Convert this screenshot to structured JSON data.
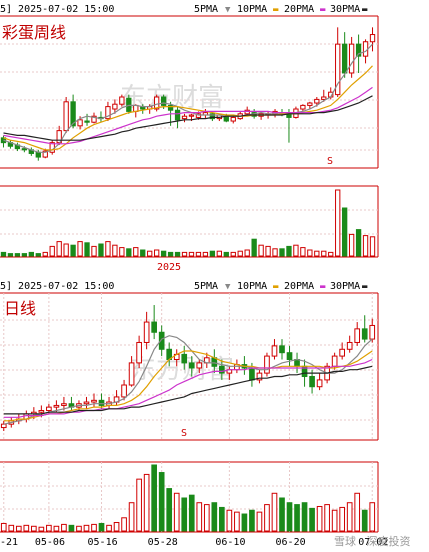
{
  "colors": {
    "up": "#d00000",
    "down": "#1a8a1a",
    "ma5": "#888888",
    "ma10": "#e0a000",
    "ma20": "#cc33cc",
    "ma30": "#222222",
    "grid_red": "#cc0000",
    "grid_dash": "#e8c8c8"
  },
  "weekly": {
    "header_left": "5] 2025-07-02 15:00",
    "title": "彩蛋周线",
    "legend": [
      "5PMA",
      "10PMA",
      "20PMA",
      "30PMA"
    ],
    "marker": "S",
    "axis_label": "2025",
    "watermark": "东方财富"
  },
  "daily": {
    "header_left": "5] 2025-07-02 15:00",
    "title": "日线",
    "legend": [
      "5PMA",
      "10PMA",
      "20PMA",
      "30PMA"
    ],
    "marker": "S",
    "watermark": "东方财富",
    "watermark_bottom": "雪球 · 深度投资",
    "x_ticks": [
      "-21",
      "05-06",
      "05-16",
      "05-28",
      "06-10",
      "06-20",
      "07-02"
    ]
  },
  "chart_data": [
    {
      "type": "candlestick",
      "title": "彩蛋周线",
      "timestamp": "2025-07-02 15:00",
      "indicators": [
        "5PMA",
        "10PMA",
        "20PMA",
        "30PMA"
      ],
      "y_range": [
        0,
        100
      ],
      "candles": [
        [
          50,
          52,
          46,
          42
        ],
        [
          46,
          48,
          43,
          41
        ],
        [
          44,
          46,
          41,
          39
        ],
        [
          41,
          43,
          40,
          38
        ],
        [
          40,
          42,
          37,
          35
        ],
        [
          38,
          40,
          34,
          31
        ],
        [
          34,
          41,
          39,
          33
        ],
        [
          38,
          48,
          46,
          36
        ],
        [
          46,
          60,
          56,
          44
        ],
        [
          56,
          84,
          80,
          54
        ],
        [
          80,
          86,
          60,
          58
        ],
        [
          60,
          68,
          65,
          57
        ],
        [
          64,
          70,
          63,
          60
        ],
        [
          63,
          71,
          68,
          62
        ],
        [
          67,
          72,
          66,
          63
        ],
        [
          66,
          80,
          76,
          64
        ],
        [
          74,
          82,
          78,
          70
        ],
        [
          78,
          86,
          84,
          76
        ],
        [
          83,
          86,
          72,
          70
        ],
        [
          72,
          78,
          77,
          67
        ],
        [
          76,
          78,
          74,
          70
        ],
        [
          74,
          78,
          76,
          70
        ],
        [
          74,
          86,
          84,
          72
        ],
        [
          84,
          86,
          77,
          74
        ],
        [
          77,
          80,
          73,
          60
        ],
        [
          73,
          76,
          65,
          58
        ],
        [
          66,
          70,
          68,
          63
        ],
        [
          68,
          70,
          69,
          64
        ],
        [
          67,
          72,
          70,
          65
        ],
        [
          69,
          74,
          71,
          66
        ],
        [
          70,
          72,
          66,
          64
        ],
        [
          66,
          70,
          69,
          64
        ],
        [
          68,
          70,
          64,
          63
        ],
        [
          64,
          69,
          67,
          62
        ],
        [
          66,
          72,
          70,
          65
        ],
        [
          70,
          76,
          73,
          68
        ],
        [
          71,
          74,
          68,
          66
        ],
        [
          68,
          72,
          70,
          65
        ],
        [
          69,
          72,
          70,
          66
        ],
        [
          70,
          74,
          72,
          67
        ],
        [
          71,
          74,
          70,
          68
        ],
        [
          70,
          74,
          67,
          46
        ],
        [
          67,
          76,
          74,
          66
        ],
        [
          74,
          78,
          77,
          72
        ],
        [
          77,
          80,
          79,
          74
        ],
        [
          79,
          84,
          82,
          76
        ],
        [
          82,
          90,
          84,
          80
        ],
        [
          84,
          92,
          88,
          82
        ],
        [
          86,
          142,
          128,
          84
        ],
        [
          128,
          138,
          104,
          100
        ],
        [
          104,
          134,
          128,
          100
        ],
        [
          128,
          136,
          118,
          104
        ],
        [
          118,
          132,
          130,
          112
        ],
        [
          130,
          142,
          136,
          122
        ]
      ],
      "ma5": [
        48,
        46,
        44,
        42,
        40,
        38,
        38,
        40,
        45,
        55,
        62,
        66,
        68,
        67,
        66,
        68,
        71,
        75,
        77,
        77,
        76,
        76,
        78,
        79,
        78,
        76,
        73,
        71,
        69,
        69,
        69,
        69,
        68,
        68,
        68,
        69,
        70,
        71,
        70,
        70,
        71,
        70,
        71,
        72,
        74,
        77,
        81,
        84,
        95,
        103,
        112,
        120,
        122,
        128
      ],
      "ma10": [
        50,
        48,
        47,
        46,
        44,
        42,
        40,
        40,
        41,
        45,
        50,
        54,
        58,
        61,
        63,
        65,
        67,
        69,
        71,
        72,
        73,
        74,
        75,
        76,
        76,
        76,
        75,
        74,
        73,
        72,
        71,
        70,
        69,
        69,
        68,
        68,
        69,
        69,
        69,
        69,
        70,
        70,
        70,
        71,
        72,
        73,
        75,
        77,
        82,
        88,
        94,
        99,
        104,
        110
      ],
      "ma20": [
        52,
        51,
        50,
        49,
        48,
        47,
        46,
        45,
        45,
        45,
        46,
        47,
        49,
        51,
        53,
        55,
        57,
        59,
        61,
        63,
        65,
        66,
        68,
        69,
        70,
        70,
        71,
        71,
        71,
        72,
        72,
        72,
        72,
        72,
        72,
        72,
        72,
        72,
        72,
        71,
        71,
        71,
        71,
        71,
        71,
        71,
        72,
        73,
        75,
        78,
        81,
        84,
        88,
        92
      ],
      "ma30": [
        54,
        53,
        52,
        52,
        51,
        50,
        49,
        48,
        48,
        48,
        48,
        48,
        49,
        50,
        51,
        52,
        53,
        55,
        56,
        58,
        59,
        60,
        61,
        62,
        63,
        64,
        65,
        65,
        66,
        66,
        67,
        67,
        68,
        68,
        68,
        69,
        69,
        69,
        69,
        69,
        69,
        70,
        70,
        70,
        70,
        71,
        71,
        72,
        73,
        75,
        77,
        79,
        82,
        85
      ],
      "volume": [
        3,
        2,
        2,
        2,
        3,
        2,
        3,
        8,
        12,
        10,
        9,
        12,
        11,
        8,
        10,
        12,
        9,
        7,
        6,
        7,
        5,
        4,
        5,
        4,
        3,
        3,
        3,
        3,
        3,
        3,
        4,
        4,
        3,
        3,
        4,
        5,
        14,
        9,
        8,
        6,
        6,
        8,
        9,
        7,
        5,
        4,
        4,
        3,
        55,
        40,
        18,
        22,
        17,
        16
      ]
    },
    {
      "type": "candlestick",
      "title": "日线",
      "timestamp": "2025-07-02 15:00",
      "indicators": [
        "5PMA",
        "10PMA",
        "20PMA",
        "30PMA"
      ],
      "x_ticks": [
        "-21",
        "05-06",
        "05-16",
        "05-28",
        "06-10",
        "06-20",
        "07-02"
      ],
      "candles": [
        [
          20,
          24,
          22,
          18
        ],
        [
          22,
          26,
          24,
          20
        ],
        [
          24,
          28,
          25,
          22
        ],
        [
          25,
          30,
          28,
          23
        ],
        [
          28,
          32,
          29,
          25
        ],
        [
          29,
          33,
          30,
          26
        ],
        [
          30,
          34,
          32,
          28
        ],
        [
          32,
          36,
          33,
          29
        ],
        [
          33,
          38,
          34,
          30
        ],
        [
          34,
          38,
          32,
          30
        ],
        [
          32,
          36,
          34,
          30
        ],
        [
          34,
          38,
          35,
          31
        ],
        [
          35,
          40,
          36,
          32
        ],
        [
          36,
          40,
          33,
          31
        ],
        [
          33,
          38,
          35,
          31
        ],
        [
          35,
          42,
          38,
          33
        ],
        [
          38,
          48,
          45,
          36
        ],
        [
          45,
          62,
          58,
          44
        ],
        [
          58,
          74,
          70,
          55
        ],
        [
          70,
          88,
          82,
          66
        ],
        [
          82,
          92,
          76,
          72
        ],
        [
          76,
          80,
          66,
          62
        ],
        [
          66,
          70,
          60,
          56
        ],
        [
          60,
          66,
          63,
          56
        ],
        [
          63,
          68,
          58,
          54
        ],
        [
          58,
          62,
          55,
          50
        ],
        [
          55,
          60,
          58,
          52
        ],
        [
          58,
          64,
          61,
          55
        ],
        [
          61,
          66,
          56,
          52
        ],
        [
          56,
          60,
          52,
          48
        ],
        [
          52,
          56,
          54,
          48
        ],
        [
          54,
          60,
          57,
          52
        ],
        [
          57,
          62,
          55,
          51
        ],
        [
          55,
          58,
          48,
          44
        ],
        [
          48,
          54,
          52,
          46
        ],
        [
          52,
          64,
          62,
          50
        ],
        [
          62,
          72,
          68,
          60
        ],
        [
          68,
          72,
          64,
          60
        ],
        [
          64,
          68,
          60,
          56
        ],
        [
          60,
          64,
          56,
          52
        ],
        [
          56,
          60,
          50,
          44
        ],
        [
          50,
          54,
          44,
          40
        ],
        [
          44,
          52,
          48,
          42
        ],
        [
          48,
          58,
          56,
          46
        ],
        [
          56,
          64,
          62,
          54
        ],
        [
          62,
          70,
          66,
          60
        ],
        [
          66,
          74,
          70,
          64
        ],
        [
          70,
          82,
          78,
          68
        ],
        [
          78,
          86,
          72,
          70
        ],
        [
          72,
          84,
          80,
          70
        ]
      ],
      "ma5": [
        22,
        23,
        24,
        25,
        27,
        28,
        29,
        30,
        31,
        32,
        33,
        33,
        34,
        34,
        34,
        35,
        37,
        41,
        47,
        56,
        66,
        72,
        74,
        73,
        70,
        65,
        60,
        58,
        58,
        57,
        56,
        56,
        56,
        55,
        54,
        54,
        56,
        58,
        59,
        60,
        59,
        57,
        54,
        52,
        52,
        54,
        58,
        62,
        68,
        72
      ],
      "ma10": [
        24,
        24,
        25,
        25,
        26,
        27,
        28,
        28,
        29,
        30,
        31,
        31,
        32,
        32,
        33,
        33,
        34,
        36,
        39,
        44,
        50,
        55,
        60,
        63,
        65,
        65,
        64,
        63,
        61,
        59,
        58,
        57,
        56,
        56,
        55,
        55,
        55,
        56,
        56,
        56,
        56,
        56,
        56,
        55,
        55,
        56,
        57,
        59,
        62,
        65
      ],
      "ma20": [
        26,
        26,
        26,
        27,
        27,
        27,
        28,
        28,
        28,
        29,
        29,
        30,
        30,
        31,
        31,
        31,
        32,
        33,
        34,
        36,
        38,
        40,
        42,
        45,
        47,
        49,
        51,
        52,
        53,
        53,
        54,
        54,
        54,
        55,
        55,
        55,
        55,
        55,
        55,
        55,
        55,
        55,
        55,
        55,
        56,
        56,
        56,
        57,
        58,
        60
      ],
      "ma30": [
        28,
        28,
        28,
        28,
        28,
        28,
        29,
        29,
        29,
        29,
        30,
        30,
        30,
        30,
        31,
        31,
        31,
        32,
        32,
        33,
        34,
        35,
        36,
        37,
        38,
        40,
        41,
        42,
        43,
        44,
        45,
        46,
        47,
        48,
        49,
        49,
        50,
        50,
        51,
        51,
        52,
        52,
        52,
        52,
        53,
        53,
        54,
        54,
        55,
        56
      ],
      "volume": [
        8,
        6,
        5,
        6,
        5,
        4,
        6,
        5,
        7,
        6,
        5,
        6,
        7,
        8,
        6,
        9,
        14,
        30,
        55,
        60,
        70,
        62,
        45,
        40,
        35,
        38,
        30,
        28,
        30,
        25,
        22,
        20,
        18,
        22,
        20,
        28,
        40,
        35,
        30,
        28,
        30,
        24,
        26,
        28,
        22,
        25,
        30,
        40,
        22,
        30
      ]
    }
  ]
}
